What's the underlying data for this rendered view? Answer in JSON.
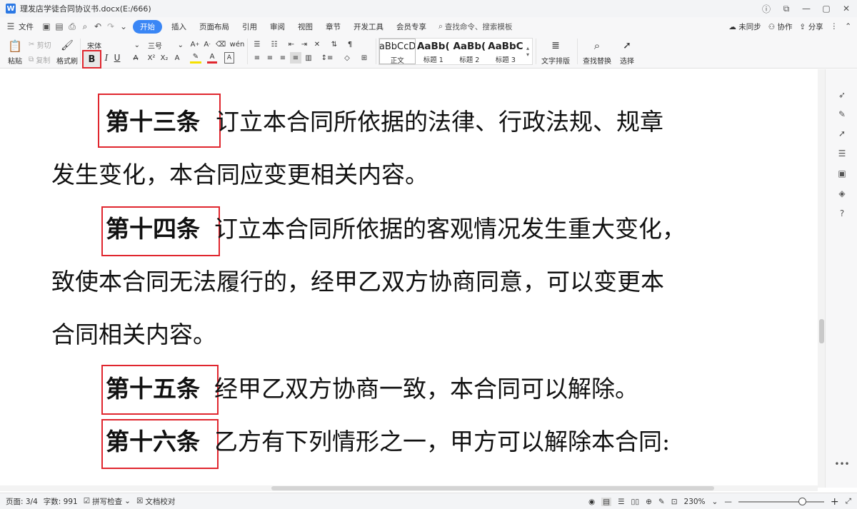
{
  "titlebar": {
    "app_logo": "W",
    "doc_title": "理发店学徒合同协议书.docx(E:/666)"
  },
  "menubar": {
    "file_label": "文件",
    "tabs": [
      "开始",
      "插入",
      "页面布局",
      "引用",
      "审阅",
      "视图",
      "章节",
      "开发工具",
      "会员专享"
    ],
    "search_placeholder": "查找命令、搜索模板",
    "sync_label": "未同步",
    "collab_label": "协作",
    "share_label": "分享"
  },
  "ribbon": {
    "paste_label": "粘贴",
    "cut_label": "剪切",
    "copy_label": "复制",
    "format_painter_label": "格式刷",
    "font_name": "宋体",
    "font_size": "三号",
    "bold_label": "B",
    "italic_label": "I",
    "underline_label": "U",
    "styles": [
      {
        "sample": "AaBbCcDd",
        "label": "正文"
      },
      {
        "sample": "AaBb(",
        "label": "标题 1"
      },
      {
        "sample": "AaBb(",
        "label": "标题 2"
      },
      {
        "sample": "AaBbC",
        "label": "标题 3"
      }
    ],
    "text_layout_label": "文字排版",
    "find_replace_label": "查找替换",
    "select_label": "选择"
  },
  "document": {
    "articles": [
      {
        "label": "第十三条",
        "lines": [
          "订立本合同所依据的法律、行政法规、规章",
          "发生变化，本合同应变更相关内容。"
        ]
      },
      {
        "label": "第十四条",
        "lines": [
          "订立本合同所依据的客观情况发生重大变化，",
          "致使本合同无法履行的，经甲乙双方协商同意，可以变更本",
          "合同相关内容。"
        ]
      },
      {
        "label": "第十五条",
        "lines": [
          "经甲乙双方协商一致，本合同可以解除。"
        ]
      },
      {
        "label": "第十六条",
        "lines": [
          "乙方有下列情形之一，甲方可以解除本合同:"
        ]
      }
    ]
  },
  "statusbar": {
    "page": "页面: 3/4",
    "words": "字数: 991",
    "spellcheck": "拼写检查",
    "proofread": "文档校对",
    "zoom": "230%"
  },
  "colors": {
    "accent": "#3a86f5",
    "highlight_box": "#e0262e"
  }
}
